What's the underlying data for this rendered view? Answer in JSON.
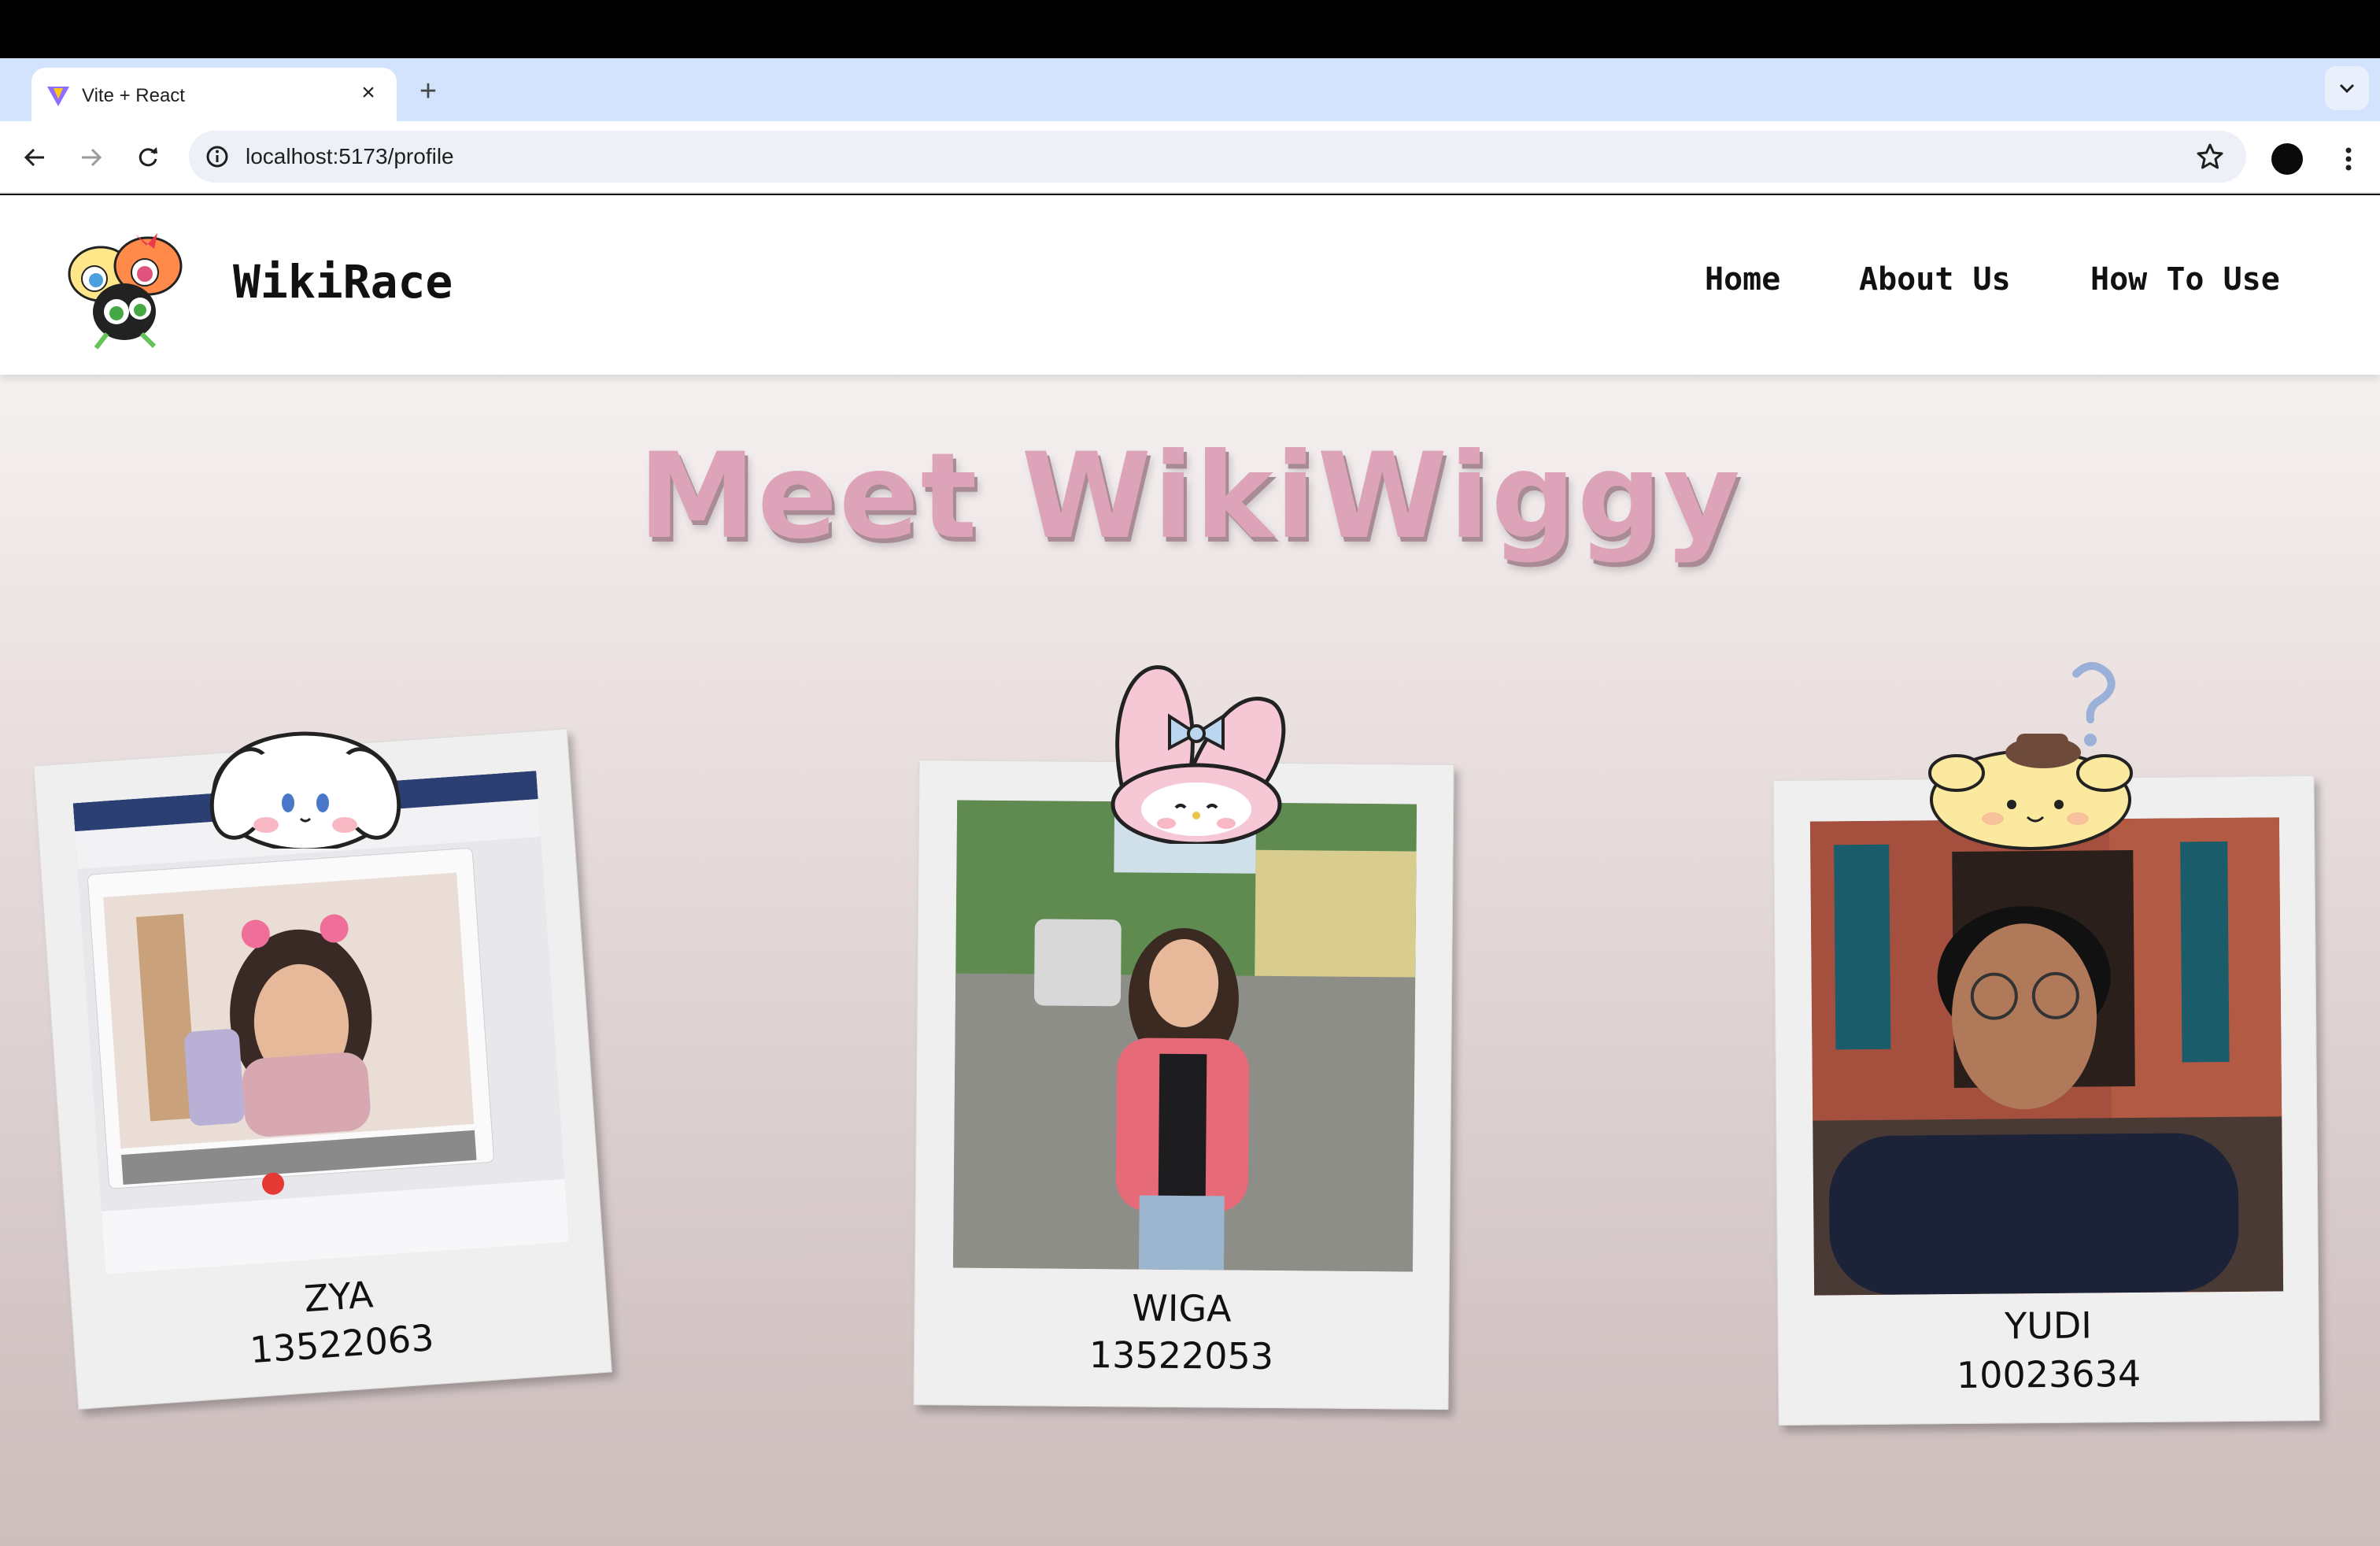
{
  "browser": {
    "tab_title": "Vite + React",
    "url": "localhost:5173/profile"
  },
  "site": {
    "brand": "WikiRace",
    "nav": [
      "Home",
      "About Us",
      "How To Use"
    ]
  },
  "headline": "Meet WikiWiggy",
  "members": [
    {
      "name": "ZYA",
      "id": "13522063",
      "mascot": "cinnamoroll-icon"
    },
    {
      "name": "WIGA",
      "id": "13522053",
      "mascot": "my-melody-icon"
    },
    {
      "name": "YUDI",
      "id": "10023634",
      "mascot": "pompompurin-icon"
    }
  ],
  "colors": {
    "headline": "#dda4b9",
    "tabbar": "#d3e3fd",
    "page_bg_top": "#faf9f9",
    "page_bg_bottom": "#cdbdbd"
  }
}
